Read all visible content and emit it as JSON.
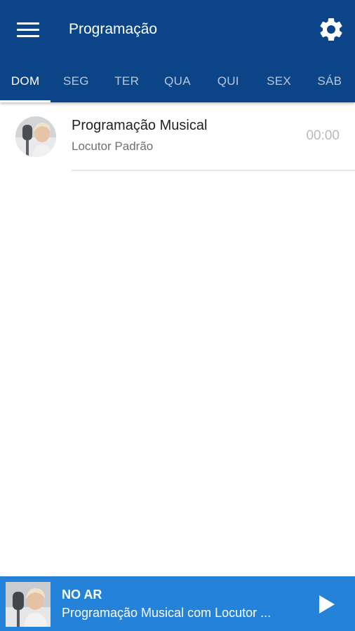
{
  "app_bar": {
    "title": "Programação",
    "menu_icon": "menu-icon",
    "settings_icon": "gear-icon",
    "color": "#0b4588"
  },
  "tabs": [
    {
      "label": "DOM",
      "active": true
    },
    {
      "label": "SEG",
      "active": false
    },
    {
      "label": "TER",
      "active": false
    },
    {
      "label": "QUA",
      "active": false
    },
    {
      "label": "QUI",
      "active": false
    },
    {
      "label": "SEX",
      "active": false
    },
    {
      "label": "SÁB",
      "active": false
    }
  ],
  "schedule": [
    {
      "title": "Programação Musical",
      "host": "Locutor Padrão",
      "time": "00:00"
    }
  ],
  "now_playing": {
    "label": "NO AR",
    "text": "Programação Musical com Locutor ...",
    "play_icon": "play-icon",
    "color": "#2483d8"
  }
}
